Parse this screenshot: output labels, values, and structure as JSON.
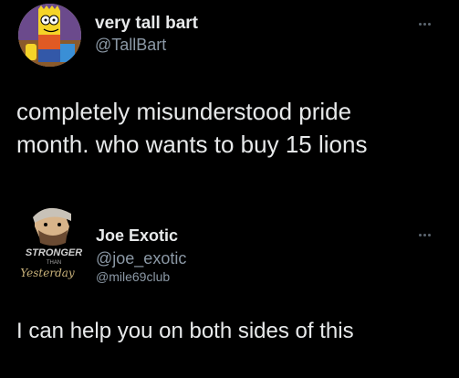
{
  "tweets": [
    {
      "display_name": "very tall bart",
      "handle": "@TallBart",
      "text_lines": [
        "completely misunderstood pride",
        "month. who wants to buy 15 lions"
      ],
      "avatar_icon": "bart-simpson-avatar",
      "more_icon": "more-options-icon"
    },
    {
      "display_name": "Joe Exotic",
      "handle": "@joe_exotic",
      "sub_handle": "@mile69club",
      "text": "I can help you on both sides of this",
      "avatar_icon": "joe-exotic-avatar",
      "avatar_text": [
        "STRONGER",
        "THAN",
        "Yesterday"
      ],
      "more_icon": "more-options-icon"
    }
  ],
  "colors": {
    "background": "#000000",
    "primary_text": "#e7e9ea",
    "secondary_text": "#8b98a5",
    "icon_gray": "#5c6670"
  }
}
